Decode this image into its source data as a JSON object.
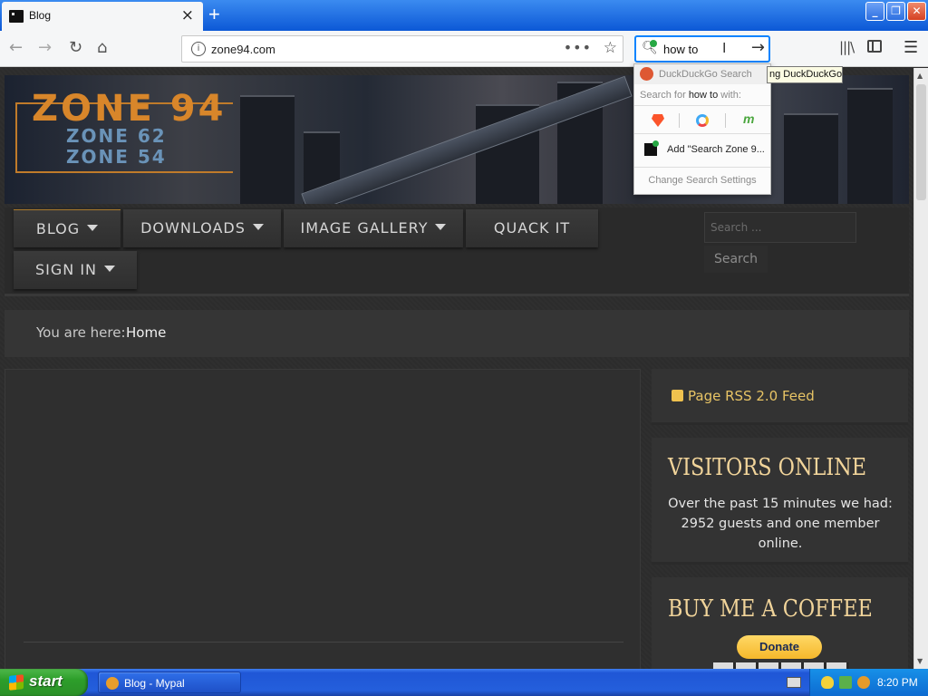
{
  "browser": {
    "tab_title": "Blog",
    "tab_close": "×",
    "new_tab": "+",
    "url": "zone94.com",
    "url_more": "•••",
    "bookmark_star": "☆",
    "search_value": "how to",
    "window_buttons": [
      "_",
      "❐",
      "✕"
    ]
  },
  "search_popup": {
    "engine_header": "DuckDuckGo Search",
    "search_for_prefix": "Search for",
    "search_for_term": "how to",
    "search_for_suffix": "with:",
    "alt_engines": [
      "brave-icon",
      "qwant-icon",
      "mojeek-icon"
    ],
    "mojeek_glyph": "m",
    "add_engine": "Add \"Search Zone 9...",
    "settings": "Change Search Settings"
  },
  "tooltip": "ng DuckDuckGo",
  "site": {
    "logo_main": "ZONE 94",
    "logo_sub1": "ZONE 62",
    "logo_sub2": "ZONE 54",
    "nav": [
      {
        "label": "BLOG",
        "dropdown": true
      },
      {
        "label": "DOWNLOADS",
        "dropdown": true
      },
      {
        "label": "IMAGE GALLERY",
        "dropdown": true
      },
      {
        "label": "QUACK IT",
        "dropdown": false
      },
      {
        "label": "SIGN IN",
        "dropdown": true
      }
    ],
    "search_placeholder": "Search ...",
    "search_button": "Search",
    "breadcrumb_prefix": "You are here:",
    "breadcrumb_home": "Home",
    "rss_label": "Page RSS 2.0 Feed",
    "visitors_title": "VISITORS ONLINE",
    "visitors_text": "Over the past 15 minutes we had: 2952 guests and one member online.",
    "coffee_title": "BUY ME A COFFEE",
    "donate_label": "Donate"
  },
  "taskbar": {
    "start_label": "start",
    "task_label": "Blog - Mypal",
    "clock": "8:20 PM"
  },
  "colors": {
    "accent_gold": "#f1d49a",
    "rss_orange": "#e8c465",
    "xp_blue": "#245fdc",
    "xp_green": "#2d9e2a"
  }
}
